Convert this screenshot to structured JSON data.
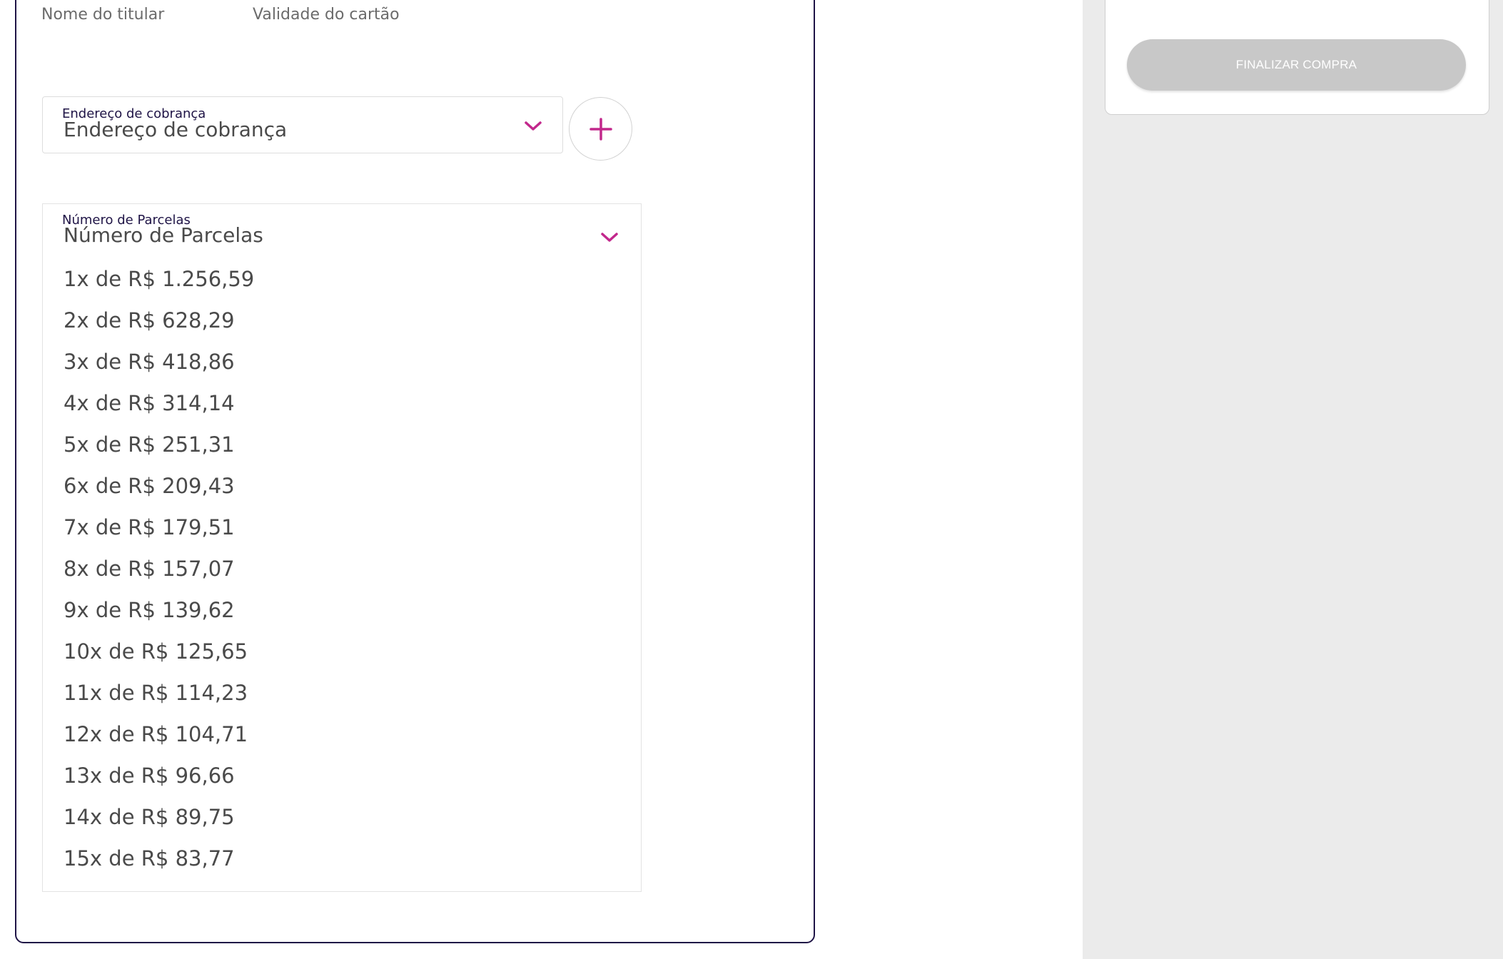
{
  "payment_form": {
    "holder_name_label": "Nome do titular",
    "card_expiry_label": "Validade do cartão",
    "billing_address": {
      "small_label": "Endereço de cobrança",
      "value": "Endereço de cobrança"
    },
    "installments": {
      "small_label": "Número de Parcelas",
      "value": "Número de Parcelas",
      "options": [
        "1x de R$ 1.256,59",
        "2x de R$ 628,29",
        "3x de R$ 418,86",
        "4x de R$ 314,14",
        "5x de R$ 251,31",
        "6x de R$ 209,43",
        "7x de R$ 179,51",
        "8x de R$ 157,07",
        "9x de R$ 139,62",
        "10x de R$ 125,65",
        "11x de R$ 114,23",
        "12x de R$ 104,71",
        "13x de R$ 96,66",
        "14x de R$ 89,75",
        "15x de R$ 83,77"
      ]
    }
  },
  "summary": {
    "finalize_button_label": "FINALIZAR COMPRA"
  },
  "icons": {
    "accent_color": "#c2288c",
    "chevron": "chevron-down-icon",
    "add": "plus-icon"
  }
}
